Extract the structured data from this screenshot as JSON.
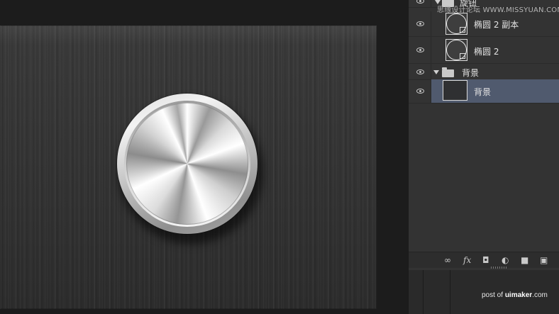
{
  "canvas": {
    "knob": "metal-knob"
  },
  "layers": [
    {
      "name": "旋钮",
      "type": "group",
      "expanded": true
    },
    {
      "name": "椭圆 2 副本",
      "type": "shape",
      "visible": true
    },
    {
      "name": "椭圆 2",
      "type": "shape",
      "visible": true
    },
    {
      "name": "背景",
      "type": "group",
      "expanded": true
    },
    {
      "name": "背景",
      "type": "layer",
      "visible": true,
      "selected": true
    }
  ],
  "watermark": "思缘设计论坛 WWW.MISSYUAN.COM",
  "footer_icons": [
    "link-icon",
    "fx-icon",
    "mask-icon",
    "adjustment-icon",
    "folder-icon",
    "new-layer-icon"
  ],
  "footer_labels": {
    "fx": "fx"
  },
  "credit": {
    "prefix": "post of ",
    "brand": "uimaker",
    "suffix": ".com"
  },
  "colors": {
    "selected_row": "#505a6e",
    "panel": "#333333"
  }
}
